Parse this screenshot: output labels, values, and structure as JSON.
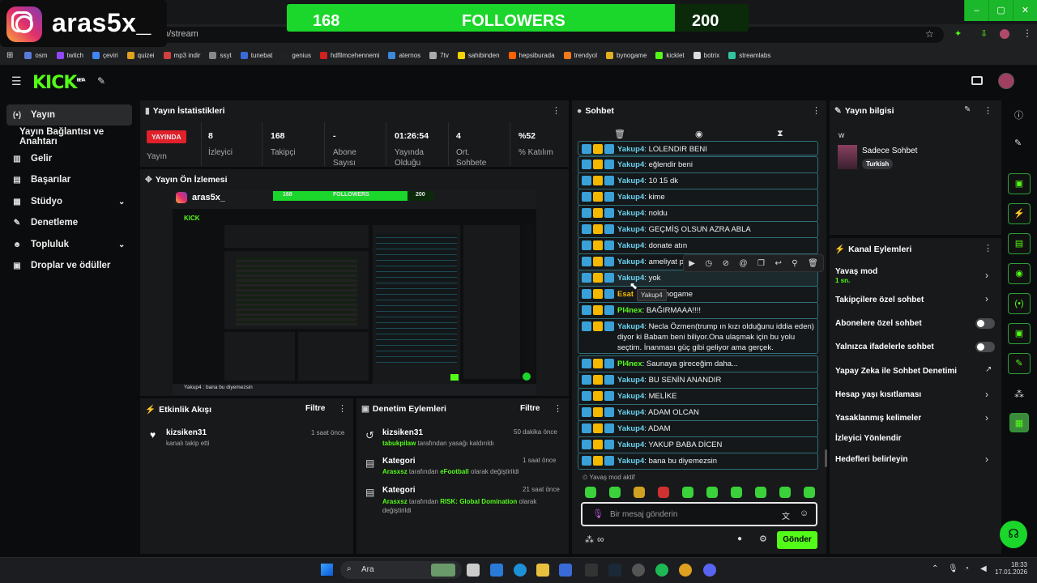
{
  "overlay": {
    "streamer_name": "aras5x_",
    "followers_current": "168",
    "followers_label": "FOLLOWERS",
    "followers_goal": "200",
    "followers_progress": 0.84
  },
  "browser": {
    "url_fragment": "n/stream",
    "bookmarks": [
      "osm",
      "twitch",
      "çeviri",
      "quizei",
      "mp3 indir",
      "ssyt",
      "tunebat",
      "genius",
      "hdfilmcehennemi",
      "aternos",
      "7tv",
      "sahibinden",
      "hepsiburada",
      "trendyol",
      "bynogame",
      "kicklet",
      "botrix",
      "streamlabs"
    ],
    "window_controls": [
      "–",
      "▢",
      "✕"
    ]
  },
  "nav": {
    "logo": "KICK",
    "logo_sup": "BETA",
    "items": [
      {
        "label": "Yayın",
        "icon": "(•)"
      },
      {
        "label": "Yayın Bağlantısı ve Anahtarı",
        "icon": ""
      },
      {
        "label": "Gelir",
        "icon": "▦"
      },
      {
        "label": "Başarılar",
        "icon": "▦"
      },
      {
        "label": "Stüdyo",
        "icon": "▦"
      },
      {
        "label": "Denetleme",
        "icon": "🔧"
      },
      {
        "label": "Topluluk",
        "icon": "👥"
      },
      {
        "label": "Droplar ve ödüller",
        "icon": "▣"
      }
    ]
  },
  "stats": {
    "title": "Yayın İstatistikleri",
    "live_badge": "YAYINDA",
    "live_label": "Yayın",
    "items": [
      {
        "value": "8",
        "label": "İzleyici"
      },
      {
        "value": "168",
        "label": "Takipçi"
      },
      {
        "value": "-",
        "label": "Abone Sayısı"
      },
      {
        "value": "01:26:54",
        "label": "Yayında Olduğu"
      },
      {
        "value": "4",
        "label": "Ort. Sohbete"
      },
      {
        "value": "%52",
        "label": "% Katılım"
      }
    ]
  },
  "preview": {
    "title": "Yayın Ön İzlemesi",
    "bottom_text": "Yakup4 : bana bu diyemezsin"
  },
  "activity": {
    "title": "Etkinlik Akışı",
    "filter": "Filtre",
    "items": [
      {
        "user": "kizsiken31",
        "desc": "kanalı takip etti",
        "time": "1 saat önce"
      }
    ]
  },
  "moderation": {
    "title": "Denetim Eylemleri",
    "filter": "Filtre",
    "items": [
      {
        "title": "kizsiken31",
        "user": "tabukpilaw",
        "desc": "tarafından yasağı kaldırıldı",
        "time": "50 dakika önce"
      },
      {
        "title": "Kategori",
        "user": "Arasxsz",
        "desc": "tarafından",
        "value": "eFootball",
        "desc2": "olarak değiştirildi",
        "time": "1 saat önce"
      },
      {
        "title": "Kategori",
        "user": "Arasxsz",
        "desc": "tarafından",
        "value": "RISK: Global Domination",
        "desc2": "olarak değiştirildi",
        "time": "21 saat önce"
      }
    ]
  },
  "chat": {
    "title": "Sohbet",
    "messages": [
      {
        "user": "Yakup4",
        "text": "LOLENDIR BENI"
      },
      {
        "user": "Yakup4",
        "text": "eğlendir beni"
      },
      {
        "user": "Yakup4",
        "text": "10 15 dk"
      },
      {
        "user": "Yakup4",
        "text": "kime"
      },
      {
        "user": "Yakup4",
        "text": "noldu"
      },
      {
        "user": "Yakup4",
        "text": "GEÇMİŞ OLSUN AZRA ABLA"
      },
      {
        "user": "Yakup4",
        "text": "donate atın"
      },
      {
        "user": "Yakup4",
        "text": "ameliyat pi"
      },
      {
        "user": "Yakup4",
        "text": "yok"
      },
      {
        "user": "Esat",
        "text": "nogame"
      },
      {
        "user": "Pl4nex",
        "text": "BAĞIRMAAA!!!!"
      },
      {
        "user": "Yakup4",
        "text": "Necla Özmen(trump ın kızı olduğunu iddia eden) diyor ki Babam beni biliyor.Ona ulaşmak için bu yolu seçtim. İnanması güç gibi geliyor ama gerçek."
      },
      {
        "user": "Pl4nex",
        "text": "Saunaya gireceğim daha..."
      },
      {
        "user": "Yakup4",
        "text": "BU SENİN ANANDIR"
      },
      {
        "user": "Yakup4",
        "text": "MELİKE"
      },
      {
        "user": "Yakup4",
        "text": "ADAM OLCAN"
      },
      {
        "user": "Yakup4",
        "text": "ADAM"
      },
      {
        "user": "Yakup4",
        "text": "YAKUP BABA DİCEN"
      },
      {
        "user": "Yakup4",
        "text": "bana bu diyemezsin"
      }
    ],
    "tooltip": "Yakup4",
    "slow_mode": "Yavaş mod aktif",
    "input_placeholder": "Bir mesaj gönderin",
    "send": "Gönder",
    "infinity": "∞"
  },
  "stream_info": {
    "title": "Yayın bilgisi",
    "w": "w",
    "stream_title": "Sadece Sohbet",
    "tag": "Turkish"
  },
  "channel_actions": {
    "title": "Kanal Eylemleri",
    "items": [
      {
        "label": "Yavaş mod",
        "sub": "1 sn.",
        "type": "chevron"
      },
      {
        "label": "Takipçilere özel sohbet",
        "type": "chevron"
      },
      {
        "label": "Abonelere özel sohbet",
        "type": "toggle",
        "on": false
      },
      {
        "label": "Yalnızca ifadelerle sohbet",
        "type": "toggle",
        "on": false
      },
      {
        "label": "Yapay Zeka ile Sohbet Denetimi",
        "type": "external"
      },
      {
        "label": "Hesap yaşı kısıtlaması",
        "type": "chevron"
      },
      {
        "label": "Yasaklanmış kelimeler",
        "type": "chevron"
      },
      {
        "label": "İzleyici Yönlendir",
        "type": "none"
      },
      {
        "label": "Hedefleri belirleyin",
        "type": "chevron"
      }
    ]
  },
  "taskbar": {
    "search": "Ara",
    "time": "18:33",
    "date": "17.01.2026"
  },
  "colors": {
    "accent": "#53fc18",
    "panel": "#18191b",
    "live": "#e0202a",
    "chat_border": "#2f6f7a"
  }
}
